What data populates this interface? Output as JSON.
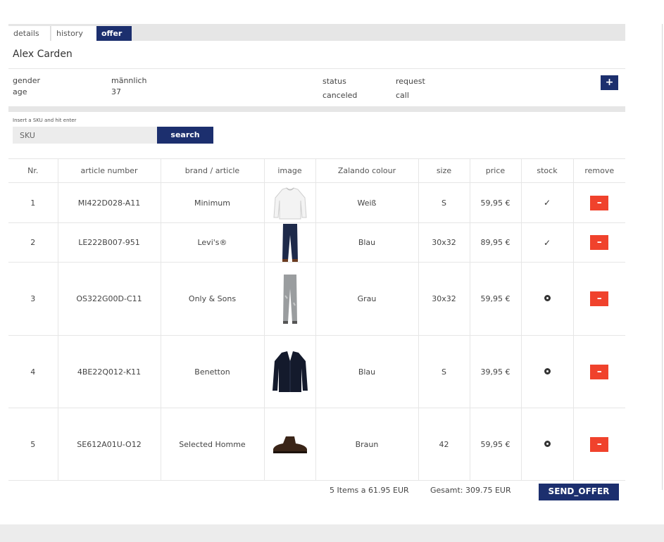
{
  "tabs": [
    {
      "label": "details"
    },
    {
      "label": "history"
    },
    {
      "label": "offer",
      "active": true
    }
  ],
  "customer": {
    "name": "Alex Carden",
    "gender_label": "gender",
    "gender_value": "männlich",
    "age_label": "age",
    "age_value": "37",
    "status_label": "status",
    "status_value": "request",
    "canceled_label": "canceled",
    "canceled_value": "call"
  },
  "actions": {
    "add_label": "+"
  },
  "search": {
    "hint": "Insert a SKU and hit enter",
    "placeholder": "SKU",
    "button_label": "search"
  },
  "table": {
    "headers": [
      "Nr.",
      "article number",
      "brand / article",
      "image",
      "Zalando colour",
      "size",
      "price",
      "stock",
      "remove"
    ],
    "rows": [
      {
        "nr": "1",
        "article": "MI422D028-A11",
        "brand": "Minimum",
        "image": "sweater-white",
        "colour": "Weiß",
        "size": "S",
        "price": "59,95 €",
        "stock": "in-stock"
      },
      {
        "nr": "2",
        "article": "LE222B007-951",
        "brand": "Levi's®",
        "image": "jeans-dark",
        "colour": "Blau",
        "size": "30x32",
        "price": "89,95 €",
        "stock": "in-stock"
      },
      {
        "nr": "3",
        "article": "OS322G00D-C11",
        "brand": "Only & Sons",
        "image": "jeans-grey",
        "colour": "Grau",
        "size": "30x32",
        "price": "59,95 €",
        "stock": "unknown"
      },
      {
        "nr": "4",
        "article": "4BE22Q012-K11",
        "brand": "Benetton",
        "image": "cardigan-navy",
        "colour": "Blau",
        "size": "S",
        "price": "39,95 €",
        "stock": "unknown"
      },
      {
        "nr": "5",
        "article": "SE612A01U-O12",
        "brand": "Selected Homme",
        "image": "boot-brown",
        "colour": "Braun",
        "size": "42",
        "price": "59,95 €",
        "stock": "unknown"
      }
    ],
    "remove_label": "–",
    "check_symbol": "✓"
  },
  "footer": {
    "items_summary": "5 Items a 61.95 EUR",
    "total": "Gesamt: 309.75 EUR",
    "send_label": "SEND_OFFER"
  },
  "colors": {
    "primary": "#1c2f6e",
    "danger": "#f0422c",
    "link": "#5a3e8a"
  }
}
